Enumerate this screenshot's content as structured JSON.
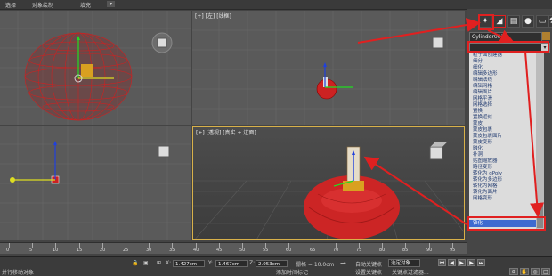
{
  "menubar": {
    "items": [
      "选择",
      "对象绘制",
      "填充"
    ]
  },
  "viewports": {
    "top_right_label": "[+] [左] [线框]",
    "bottom_right_label": "[+] [透视] [真实 + 边面]"
  },
  "panel": {
    "object_name": "Cylinder001",
    "modifier_list_value": "",
    "modifiers": [
      "粒子面创建器",
      "细分",
      "细化",
      "编辑多边形",
      "编辑法线",
      "编辑网格",
      "编辑面片",
      "网格平滑",
      "网格选择",
      "置换",
      "置换近似",
      "蒙皮",
      "蒙皮包裹",
      "蒙皮包裹面片",
      "蒙皮变形",
      "融化",
      "补洞",
      "贴图缩放器",
      "路径变形",
      "转化为 gPoly",
      "转化为多边形",
      "转化为网格",
      "转化为面片",
      "网格变形",
      "锥化"
    ],
    "selected_modifier": "锥化"
  },
  "timeline": {
    "ticks": [
      "0",
      "5",
      "10",
      "15",
      "20",
      "25",
      "30",
      "35",
      "40",
      "45",
      "50",
      "55",
      "60",
      "65",
      "70",
      "75",
      "80",
      "85",
      "90",
      "95"
    ]
  },
  "statusbar": {
    "left_text": "并行移动对象",
    "x_label": "X:",
    "x_value": "1.427cm",
    "y_label": "Y:",
    "y_value": "1.467cm",
    "z_label": "Z:",
    "z_value": "2.053cm",
    "grid_text": "栅格 = 10.0cm",
    "autokey_label": "自动关键点",
    "set_key_label": "设置关键点",
    "selected_label": "选定对象",
    "add_time_tag": "添加时间标记",
    "key_filter": "关键点过滤器..."
  },
  "colors": {
    "annotation_red": "#e02020",
    "viewport_active_border": "#d8b14a",
    "selection_blue": "#3d6ad0"
  }
}
